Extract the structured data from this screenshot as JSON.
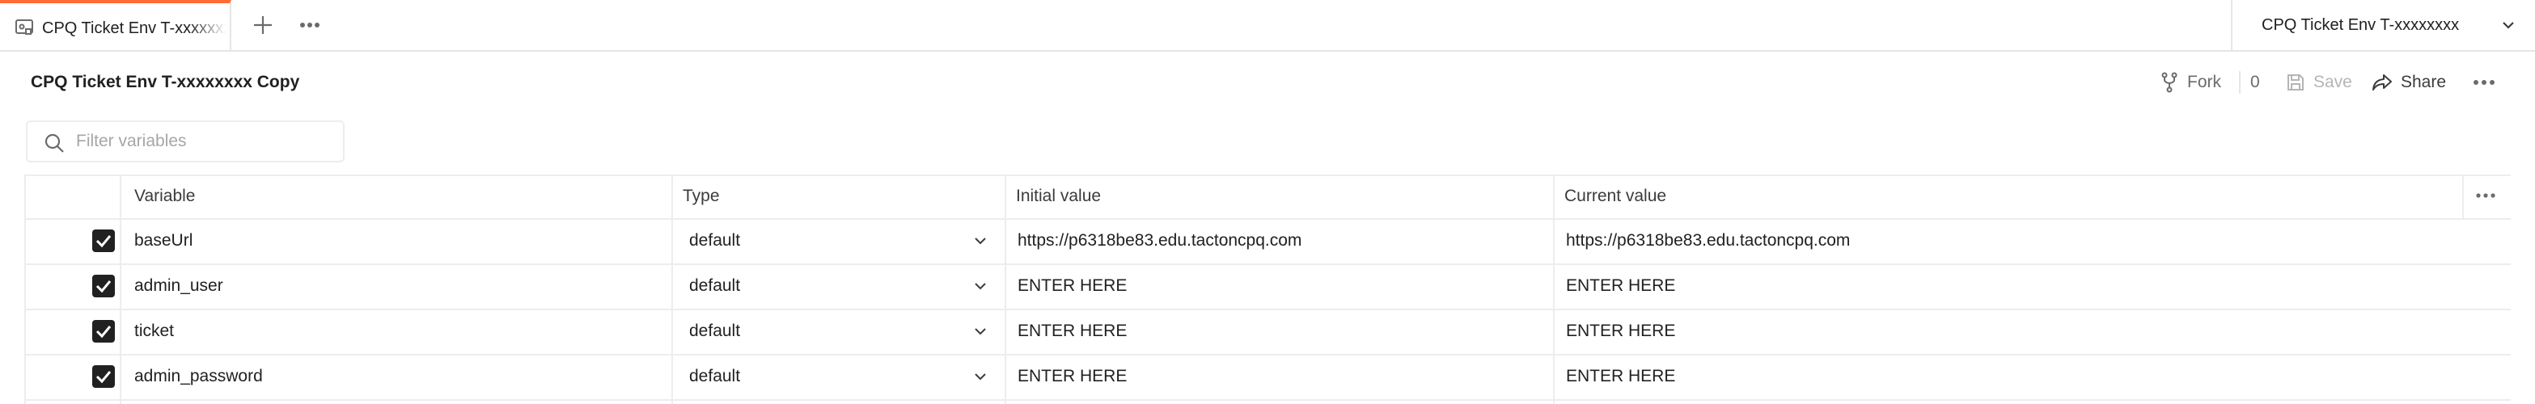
{
  "tab": {
    "label": "CPQ Ticket Env T-xxxxxxxx Copy"
  },
  "env_selector": {
    "label": "CPQ Ticket Env T-xxxxxxxx"
  },
  "header": {
    "title": "CPQ Ticket Env T-xxxxxxxx Copy",
    "fork_label": "Fork",
    "fork_count": "0",
    "save_label": "Save",
    "share_label": "Share"
  },
  "search": {
    "placeholder": "Filter variables",
    "value": ""
  },
  "table": {
    "columns": [
      "Variable",
      "Type",
      "Initial value",
      "Current value"
    ],
    "rows": [
      {
        "enabled": true,
        "variable": "baseUrl",
        "type": "default",
        "initial": "https://p6318be83.edu.tactoncpq.com",
        "current": "https://p6318be83.edu.tactoncpq.com"
      },
      {
        "enabled": true,
        "variable": "admin_user",
        "type": "default",
        "initial": "ENTER  HERE",
        "current": "ENTER  HERE"
      },
      {
        "enabled": true,
        "variable": "ticket",
        "type": "default",
        "initial": "ENTER  HERE",
        "current": "ENTER  HERE"
      },
      {
        "enabled": true,
        "variable": "admin_password",
        "type": "default",
        "initial": "ENTER  HERE",
        "current": "ENTER  HERE"
      }
    ]
  },
  "colors": {
    "accent": "#ff6c37",
    "border": "#ededed",
    "text": "#212121",
    "muted": "#6b6b6b"
  },
  "icons": [
    "environment-icon",
    "plus-icon",
    "ellipsis-icon",
    "chevron-down-icon",
    "fork-icon",
    "save-icon",
    "share-icon",
    "search-icon",
    "checkbox-icon"
  ]
}
